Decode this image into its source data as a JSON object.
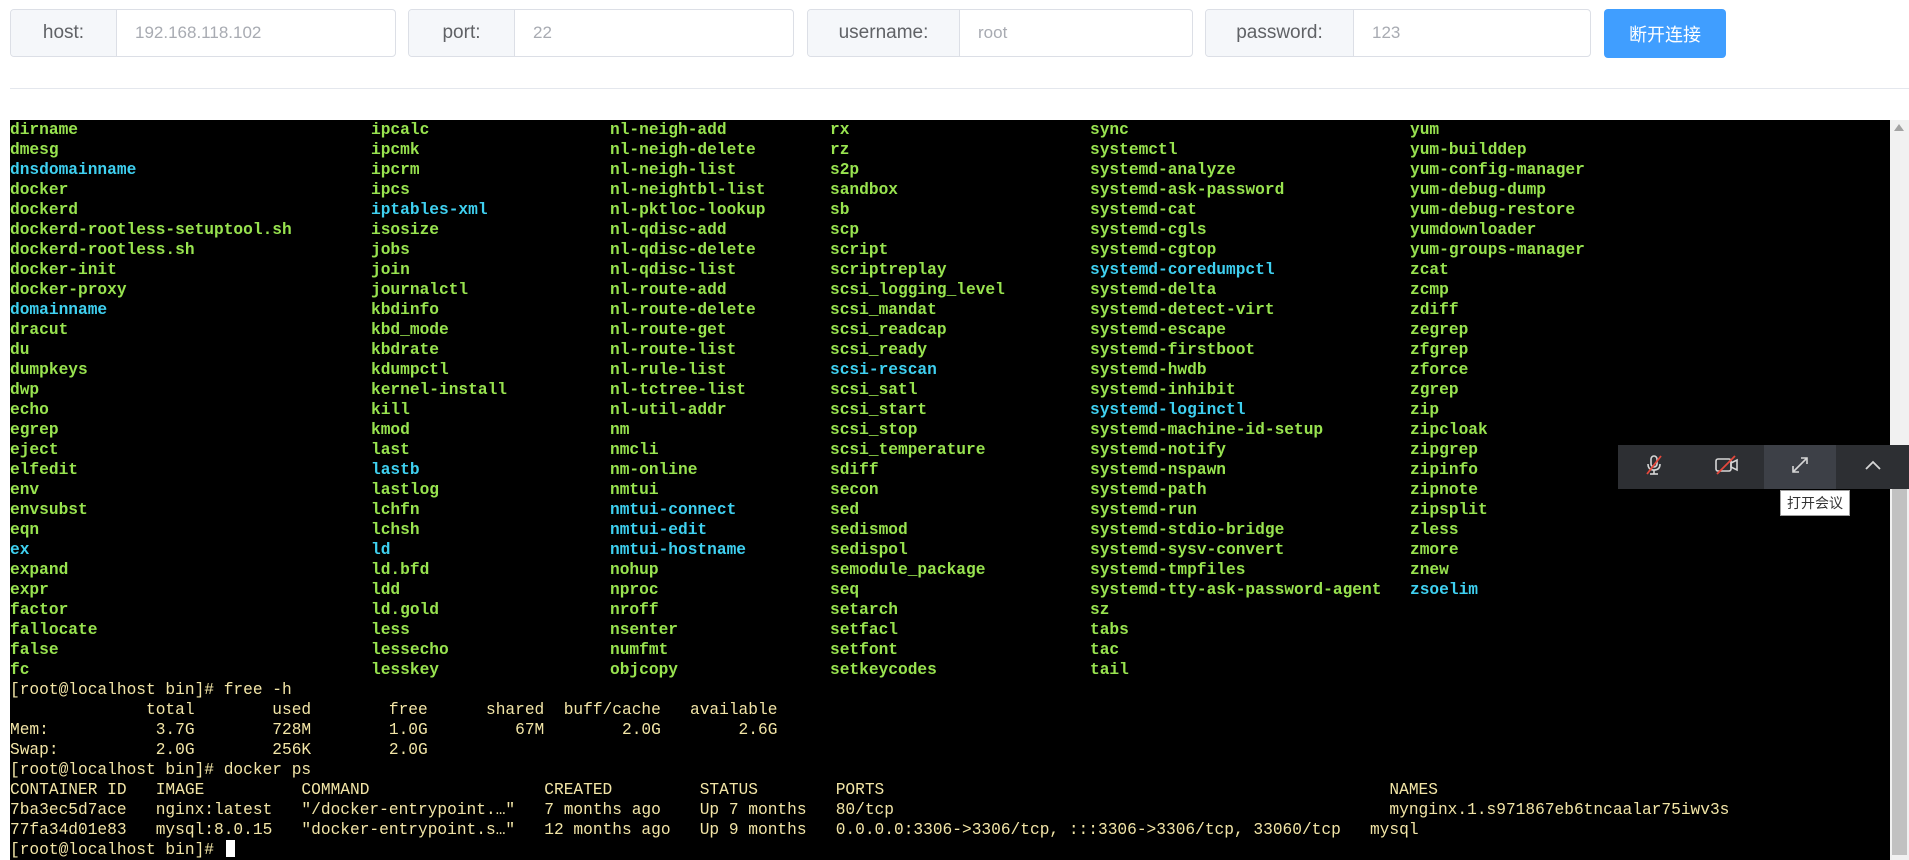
{
  "connection": {
    "host": {
      "label": "host:",
      "value": "192.168.118.102"
    },
    "port": {
      "label": "port:",
      "value": "22"
    },
    "username": {
      "label": "username:",
      "value": "root"
    },
    "password": {
      "label": "password:",
      "value": "123"
    },
    "disconnect_label": "断开连接"
  },
  "terminal": {
    "colors": {
      "background": "#000000",
      "executable": "#98e34f",
      "link": "#3fd0f0",
      "output": "#f2e5a6"
    },
    "columns": [
      [
        {
          "t": "dirname",
          "c": "g"
        },
        {
          "t": "dmesg",
          "c": "g"
        },
        {
          "t": "dnsdomainname",
          "c": "c"
        },
        {
          "t": "docker",
          "c": "g"
        },
        {
          "t": "dockerd",
          "c": "g"
        },
        {
          "t": "dockerd-rootless-setuptool.sh",
          "c": "g"
        },
        {
          "t": "dockerd-rootless.sh",
          "c": "g"
        },
        {
          "t": "docker-init",
          "c": "g"
        },
        {
          "t": "docker-proxy",
          "c": "g"
        },
        {
          "t": "domainname",
          "c": "c"
        },
        {
          "t": "dracut",
          "c": "g"
        },
        {
          "t": "du",
          "c": "g"
        },
        {
          "t": "dumpkeys",
          "c": "g"
        },
        {
          "t": "dwp",
          "c": "g"
        },
        {
          "t": "echo",
          "c": "g"
        },
        {
          "t": "egrep",
          "c": "g"
        },
        {
          "t": "eject",
          "c": "g"
        },
        {
          "t": "elfedit",
          "c": "g"
        },
        {
          "t": "env",
          "c": "g"
        },
        {
          "t": "envsubst",
          "c": "g"
        },
        {
          "t": "eqn",
          "c": "g"
        },
        {
          "t": "ex",
          "c": "c"
        },
        {
          "t": "expand",
          "c": "g"
        },
        {
          "t": "expr",
          "c": "g"
        },
        {
          "t": "factor",
          "c": "g"
        },
        {
          "t": "fallocate",
          "c": "g"
        },
        {
          "t": "false",
          "c": "g"
        },
        {
          "t": "fc",
          "c": "g"
        }
      ],
      [
        {
          "t": "ipcalc",
          "c": "g"
        },
        {
          "t": "ipcmk",
          "c": "g"
        },
        {
          "t": "ipcrm",
          "c": "g"
        },
        {
          "t": "ipcs",
          "c": "g"
        },
        {
          "t": "iptables-xml",
          "c": "c"
        },
        {
          "t": "isosize",
          "c": "g"
        },
        {
          "t": "jobs",
          "c": "g"
        },
        {
          "t": "join",
          "c": "g"
        },
        {
          "t": "journalctl",
          "c": "g"
        },
        {
          "t": "kbdinfo",
          "c": "g"
        },
        {
          "t": "kbd_mode",
          "c": "g"
        },
        {
          "t": "kbdrate",
          "c": "g"
        },
        {
          "t": "kdumpctl",
          "c": "g"
        },
        {
          "t": "kernel-install",
          "c": "g"
        },
        {
          "t": "kill",
          "c": "g"
        },
        {
          "t": "kmod",
          "c": "g"
        },
        {
          "t": "last",
          "c": "g"
        },
        {
          "t": "lastb",
          "c": "c"
        },
        {
          "t": "lastlog",
          "c": "g"
        },
        {
          "t": "lchfn",
          "c": "g"
        },
        {
          "t": "lchsh",
          "c": "g"
        },
        {
          "t": "ld",
          "c": "c"
        },
        {
          "t": "ld.bfd",
          "c": "g"
        },
        {
          "t": "ldd",
          "c": "g"
        },
        {
          "t": "ld.gold",
          "c": "g"
        },
        {
          "t": "less",
          "c": "g"
        },
        {
          "t": "lessecho",
          "c": "g"
        },
        {
          "t": "lesskey",
          "c": "g"
        }
      ],
      [
        {
          "t": "nl-neigh-add",
          "c": "g"
        },
        {
          "t": "nl-neigh-delete",
          "c": "g"
        },
        {
          "t": "nl-neigh-list",
          "c": "g"
        },
        {
          "t": "nl-neightbl-list",
          "c": "g"
        },
        {
          "t": "nl-pktloc-lookup",
          "c": "g"
        },
        {
          "t": "nl-qdisc-add",
          "c": "g"
        },
        {
          "t": "nl-qdisc-delete",
          "c": "g"
        },
        {
          "t": "nl-qdisc-list",
          "c": "g"
        },
        {
          "t": "nl-route-add",
          "c": "g"
        },
        {
          "t": "nl-route-delete",
          "c": "g"
        },
        {
          "t": "nl-route-get",
          "c": "g"
        },
        {
          "t": "nl-route-list",
          "c": "g"
        },
        {
          "t": "nl-rule-list",
          "c": "g"
        },
        {
          "t": "nl-tctree-list",
          "c": "g"
        },
        {
          "t": "nl-util-addr",
          "c": "g"
        },
        {
          "t": "nm",
          "c": "g"
        },
        {
          "t": "nmcli",
          "c": "g"
        },
        {
          "t": "nm-online",
          "c": "g"
        },
        {
          "t": "nmtui",
          "c": "g"
        },
        {
          "t": "nmtui-connect",
          "c": "c"
        },
        {
          "t": "nmtui-edit",
          "c": "c"
        },
        {
          "t": "nmtui-hostname",
          "c": "c"
        },
        {
          "t": "nohup",
          "c": "g"
        },
        {
          "t": "nproc",
          "c": "g"
        },
        {
          "t": "nroff",
          "c": "g"
        },
        {
          "t": "nsenter",
          "c": "g"
        },
        {
          "t": "numfmt",
          "c": "g"
        },
        {
          "t": "objcopy",
          "c": "g"
        }
      ],
      [
        {
          "t": "rx",
          "c": "g"
        },
        {
          "t": "rz",
          "c": "g"
        },
        {
          "t": "s2p",
          "c": "g"
        },
        {
          "t": "sandbox",
          "c": "g"
        },
        {
          "t": "sb",
          "c": "g"
        },
        {
          "t": "scp",
          "c": "g"
        },
        {
          "t": "script",
          "c": "g"
        },
        {
          "t": "scriptreplay",
          "c": "g"
        },
        {
          "t": "scsi_logging_level",
          "c": "g"
        },
        {
          "t": "scsi_mandat",
          "c": "g"
        },
        {
          "t": "scsi_readcap",
          "c": "g"
        },
        {
          "t": "scsi_ready",
          "c": "g"
        },
        {
          "t": "scsi-rescan",
          "c": "c"
        },
        {
          "t": "scsi_satl",
          "c": "g"
        },
        {
          "t": "scsi_start",
          "c": "g"
        },
        {
          "t": "scsi_stop",
          "c": "g"
        },
        {
          "t": "scsi_temperature",
          "c": "g"
        },
        {
          "t": "sdiff",
          "c": "g"
        },
        {
          "t": "secon",
          "c": "g"
        },
        {
          "t": "sed",
          "c": "g"
        },
        {
          "t": "sedismod",
          "c": "g"
        },
        {
          "t": "sedispol",
          "c": "g"
        },
        {
          "t": "semodule_package",
          "c": "g"
        },
        {
          "t": "seq",
          "c": "g"
        },
        {
          "t": "setarch",
          "c": "g"
        },
        {
          "t": "setfacl",
          "c": "g"
        },
        {
          "t": "setfont",
          "c": "g"
        },
        {
          "t": "setkeycodes",
          "c": "g"
        }
      ],
      [
        {
          "t": "sync",
          "c": "g"
        },
        {
          "t": "systemctl",
          "c": "g"
        },
        {
          "t": "systemd-analyze",
          "c": "g"
        },
        {
          "t": "systemd-ask-password",
          "c": "g"
        },
        {
          "t": "systemd-cat",
          "c": "g"
        },
        {
          "t": "systemd-cgls",
          "c": "g"
        },
        {
          "t": "systemd-cgtop",
          "c": "g"
        },
        {
          "t": "systemd-coredumpctl",
          "c": "c"
        },
        {
          "t": "systemd-delta",
          "c": "g"
        },
        {
          "t": "systemd-detect-virt",
          "c": "g"
        },
        {
          "t": "systemd-escape",
          "c": "g"
        },
        {
          "t": "systemd-firstboot",
          "c": "g"
        },
        {
          "t": "systemd-hwdb",
          "c": "g"
        },
        {
          "t": "systemd-inhibit",
          "c": "g"
        },
        {
          "t": "systemd-loginctl",
          "c": "c"
        },
        {
          "t": "systemd-machine-id-setup",
          "c": "g"
        },
        {
          "t": "systemd-notify",
          "c": "g"
        },
        {
          "t": "systemd-nspawn",
          "c": "g"
        },
        {
          "t": "systemd-path",
          "c": "g"
        },
        {
          "t": "systemd-run",
          "c": "g"
        },
        {
          "t": "systemd-stdio-bridge",
          "c": "g"
        },
        {
          "t": "systemd-sysv-convert",
          "c": "g"
        },
        {
          "t": "systemd-tmpfiles",
          "c": "g"
        },
        {
          "t": "systemd-tty-ask-password-agent",
          "c": "g"
        },
        {
          "t": "sz",
          "c": "g"
        },
        {
          "t": "tabs",
          "c": "g"
        },
        {
          "t": "tac",
          "c": "g"
        },
        {
          "t": "tail",
          "c": "g"
        }
      ],
      [
        {
          "t": "yum",
          "c": "g"
        },
        {
          "t": "yum-builddep",
          "c": "g"
        },
        {
          "t": "yum-config-manager",
          "c": "g"
        },
        {
          "t": "yum-debug-dump",
          "c": "g"
        },
        {
          "t": "yum-debug-restore",
          "c": "g"
        },
        {
          "t": "yumdownloader",
          "c": "g"
        },
        {
          "t": "yum-groups-manager",
          "c": "g"
        },
        {
          "t": "zcat",
          "c": "g"
        },
        {
          "t": "zcmp",
          "c": "g"
        },
        {
          "t": "zdiff",
          "c": "g"
        },
        {
          "t": "zegrep",
          "c": "g"
        },
        {
          "t": "zfgrep",
          "c": "g"
        },
        {
          "t": "zforce",
          "c": "g"
        },
        {
          "t": "zgrep",
          "c": "g"
        },
        {
          "t": "zip",
          "c": "g"
        },
        {
          "t": "zipcloak",
          "c": "g"
        },
        {
          "t": "zipgrep",
          "c": "g"
        },
        {
          "t": "zipinfo",
          "c": "g"
        },
        {
          "t": "zipnote",
          "c": "g"
        },
        {
          "t": "zipsplit",
          "c": "g"
        },
        {
          "t": "zless",
          "c": "g"
        },
        {
          "t": "zmore",
          "c": "g"
        },
        {
          "t": "znew",
          "c": "g"
        },
        {
          "t": "zsoelim",
          "c": "c"
        }
      ]
    ],
    "output_lines": [
      "[root@localhost bin]# free -h",
      "              total        used        free      shared  buff/cache   available",
      "Mem:           3.7G        728M        1.0G         67M        2.0G        2.6G",
      "Swap:          2.0G        256K        2.0G",
      "[root@localhost bin]# docker ps",
      "CONTAINER ID   IMAGE          COMMAND                  CREATED         STATUS        PORTS                                                    NAMES",
      "7ba3ec5d7ace   nginx:latest   \"/docker-entrypoint.…\"   7 months ago    Up 7 months   80/tcp                                                   mynginx.1.s971867eb6tncaalar75iwv3s",
      "77fa34d01e83   mysql:8.0.15   \"docker-entrypoint.s…\"   12 months ago   Up 9 months   0.0.0.0:3306->3306/tcp, :::3306->3306/tcp, 33060/tcp   mysql"
    ],
    "prompt": "[root@localhost bin]# "
  },
  "meeting_toolbar": {
    "buttons": [
      {
        "icon": "mic-muted-icon"
      },
      {
        "icon": "camera-off-icon"
      },
      {
        "icon": "fullscreen-icon"
      },
      {
        "icon": "chevron-up-icon"
      }
    ],
    "tooltip": "打开会议"
  }
}
